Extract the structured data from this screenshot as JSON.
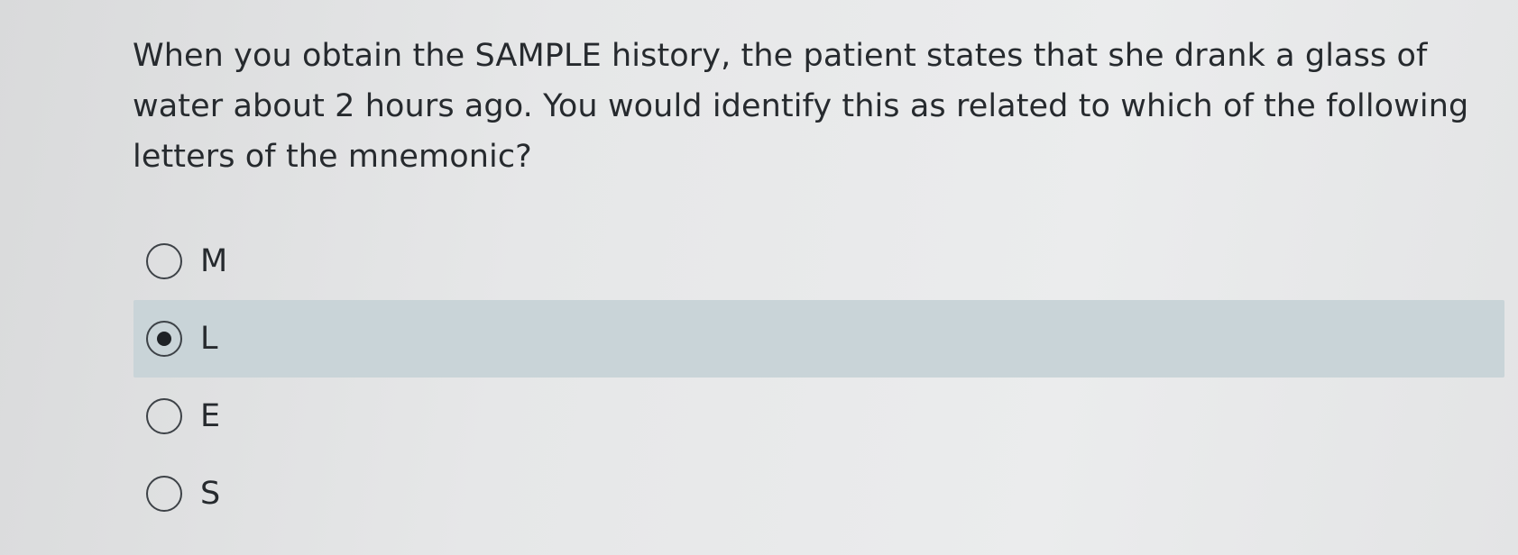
{
  "question": {
    "text": "When you obtain the SAMPLE history, the patient states that she drank a glass of water about 2 hours ago. You would identify this as related to which of the following letters of the mnemonic?"
  },
  "options": [
    {
      "label": "M",
      "selected": false
    },
    {
      "label": "L",
      "selected": true
    },
    {
      "label": "E",
      "selected": false
    },
    {
      "label": "S",
      "selected": false
    }
  ],
  "colors": {
    "selected_row_background": "#c9d4d8",
    "text": "#262a2e"
  }
}
